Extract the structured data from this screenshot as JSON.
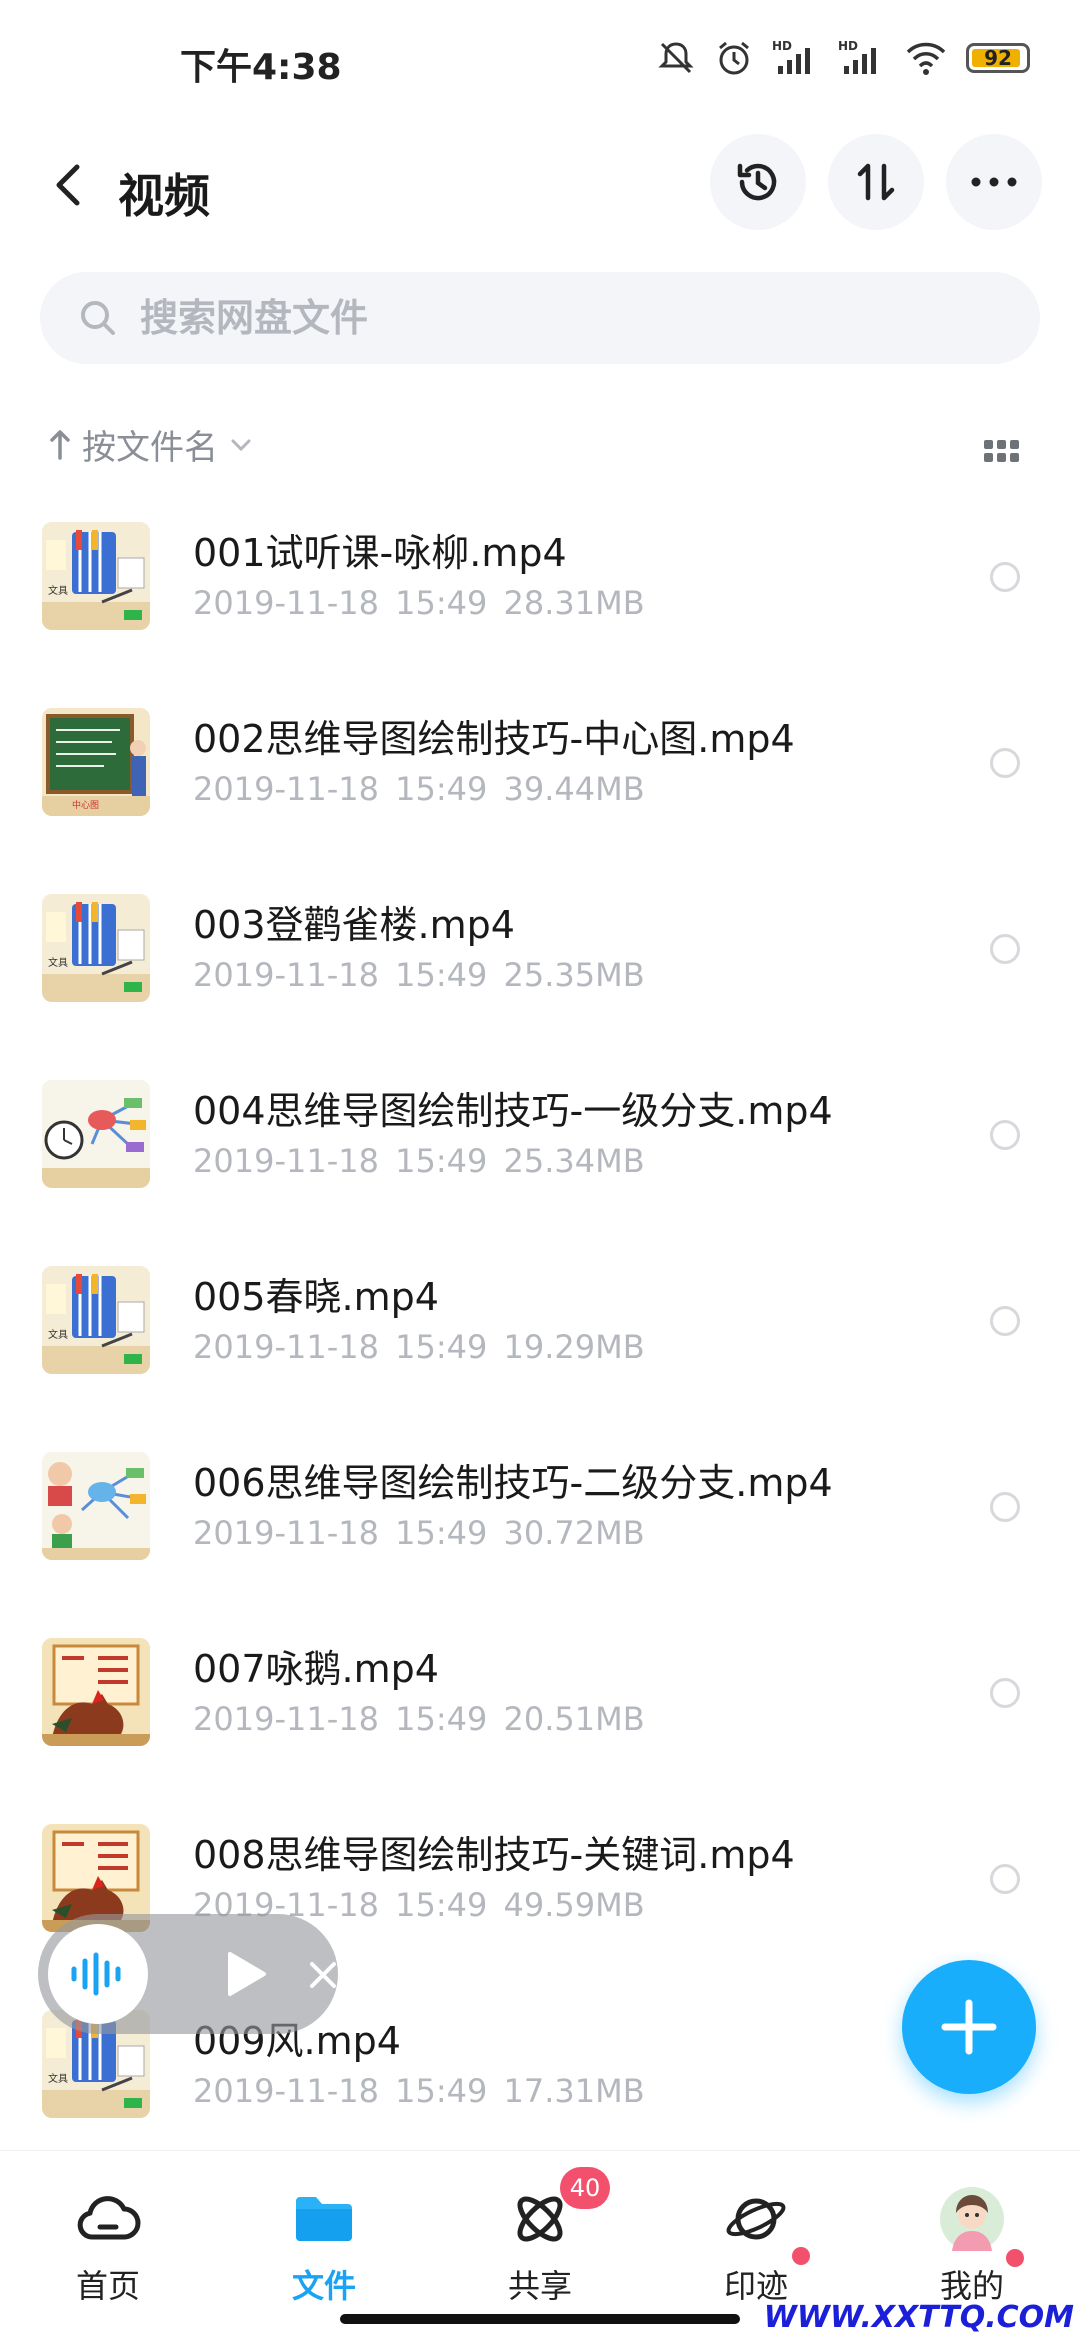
{
  "status": {
    "time": "下午4:38",
    "battery": "92",
    "battery_level": 0.92
  },
  "header": {
    "title": "视频",
    "icons": [
      "back-icon",
      "history-icon",
      "sort-swap-icon",
      "more-icon"
    ]
  },
  "search": {
    "placeholder": "搜索网盘文件"
  },
  "sort": {
    "label": "按文件名"
  },
  "files": [
    {
      "name": "001试听课-咏柳.mp4",
      "date": "2019-11-18",
      "time": "15:49",
      "size": "28.31MB",
      "thumb": "pencils"
    },
    {
      "name": "002思维导图绘制技巧-中心图.mp4",
      "date": "2019-11-18",
      "time": "15:49",
      "size": "39.44MB",
      "thumb": "blackboard"
    },
    {
      "name": "003登鹳雀楼.mp4",
      "date": "2019-11-18",
      "time": "15:49",
      "size": "25.35MB",
      "thumb": "pencils"
    },
    {
      "name": "004思维导图绘制技巧-一级分支.mp4",
      "date": "2019-11-18",
      "time": "15:49",
      "size": "25.34MB",
      "thumb": "mindmap-clock"
    },
    {
      "name": "005春晓.mp4",
      "date": "2019-11-18",
      "time": "15:49",
      "size": "19.29MB",
      "thumb": "pencils"
    },
    {
      "name": "006思维导图绘制技巧-二级分支.mp4",
      "date": "2019-11-18",
      "time": "15:49",
      "size": "30.72MB",
      "thumb": "mindmap-kid"
    },
    {
      "name": "007咏鹅.mp4",
      "date": "2019-11-18",
      "time": "15:49",
      "size": "20.51MB",
      "thumb": "rooster"
    },
    {
      "name": "008思维导图绘制技巧-关键词.mp4",
      "date": "2019-11-18",
      "time": "15:49",
      "size": "49.59MB",
      "thumb": "rooster"
    },
    {
      "name": "009风.mp4",
      "date": "2019-11-18",
      "time": "15:49",
      "size": "17.31MB",
      "thumb": "pencils"
    }
  ],
  "nav": [
    {
      "label": "首页",
      "icon": "cloud-icon"
    },
    {
      "label": "文件",
      "icon": "folder-icon",
      "active": true
    },
    {
      "label": "共享",
      "icon": "atom-icon",
      "badge": "40"
    },
    {
      "label": "印迹",
      "icon": "planet-icon",
      "dot": true
    },
    {
      "label": "我的",
      "icon": "avatar",
      "dot": true
    }
  ],
  "watermark": "WWW.XXTTQ.COM",
  "colors": {
    "accent": "#1aa3f4",
    "fab": "#18aefc",
    "badge": "#f2506c"
  }
}
